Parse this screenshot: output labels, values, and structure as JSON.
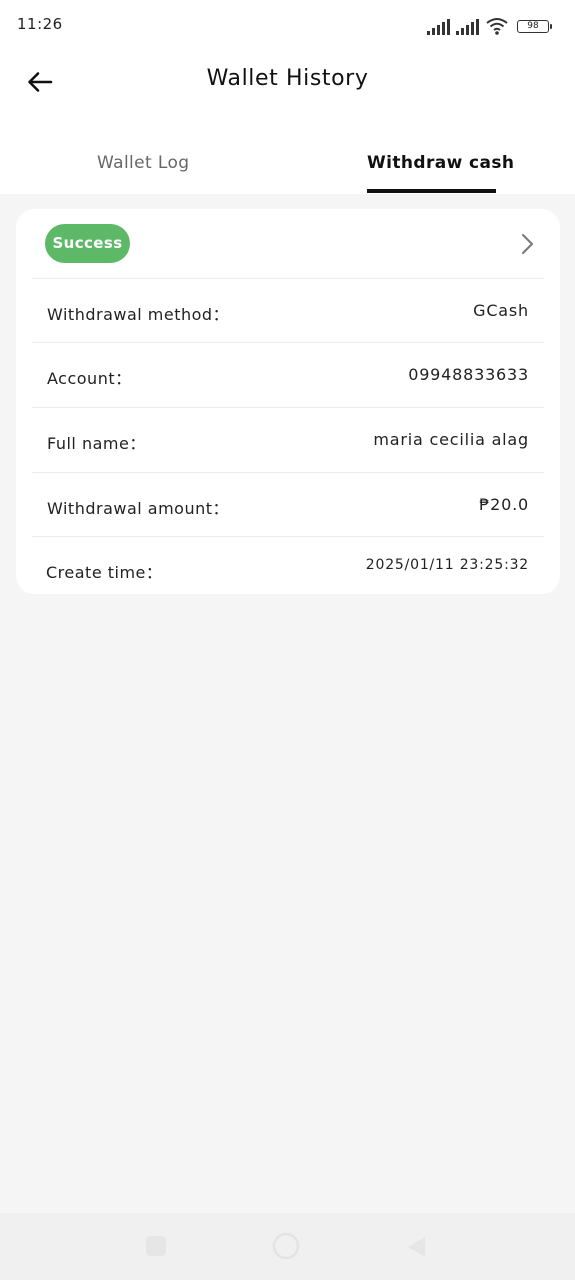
{
  "status_bar": {
    "time": "11:26",
    "battery": "98"
  },
  "header": {
    "title": "Wallet History",
    "back_icon": "arrow-left-icon"
  },
  "tabs": [
    {
      "label": "Wallet Log",
      "active": false
    },
    {
      "label": "Withdraw cash",
      "active": true
    }
  ],
  "record": {
    "status": "Success",
    "status_color": "#5db968",
    "rows": [
      {
        "label": "Withdrawal method：",
        "value": "GCash"
      },
      {
        "label": "Account：",
        "value": "09948833633"
      },
      {
        "label": "Full name：",
        "value": "maria cecilia alag"
      },
      {
        "label": "Withdrawal amount：",
        "value": "₱20.0"
      },
      {
        "label": "Create time：",
        "value": "2025/01/11 23:25:32"
      }
    ]
  },
  "colors": {
    "background": "#f5f5f5",
    "card": "#ffffff",
    "accent": "#111111"
  },
  "nav_bar": {
    "buttons": [
      "square-icon",
      "circle-icon",
      "triangle-back-icon"
    ]
  }
}
